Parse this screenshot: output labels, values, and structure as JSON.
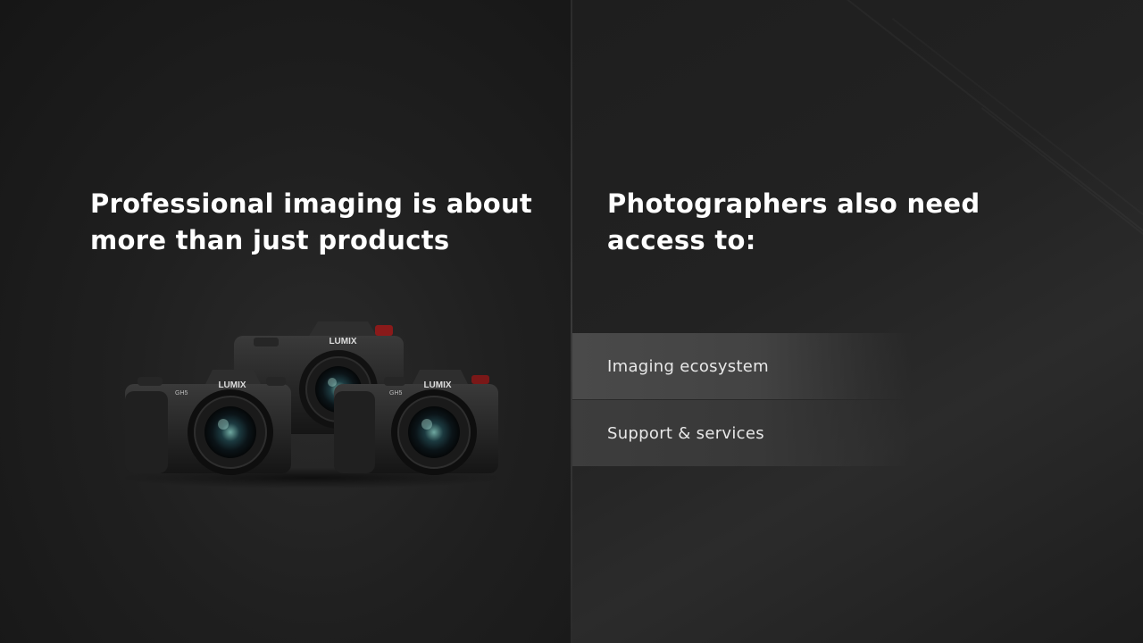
{
  "left": {
    "headline_line1": "Professional imaging is about",
    "headline_line2": "more than just products",
    "cameras": {
      "brand_label": "LUMIX",
      "model_label": "GH5"
    }
  },
  "right": {
    "headline_line1": "Photographers also need",
    "headline_line2": "access to:",
    "menu": [
      {
        "label": "Imaging ecosystem"
      },
      {
        "label": "Support & services"
      }
    ]
  }
}
